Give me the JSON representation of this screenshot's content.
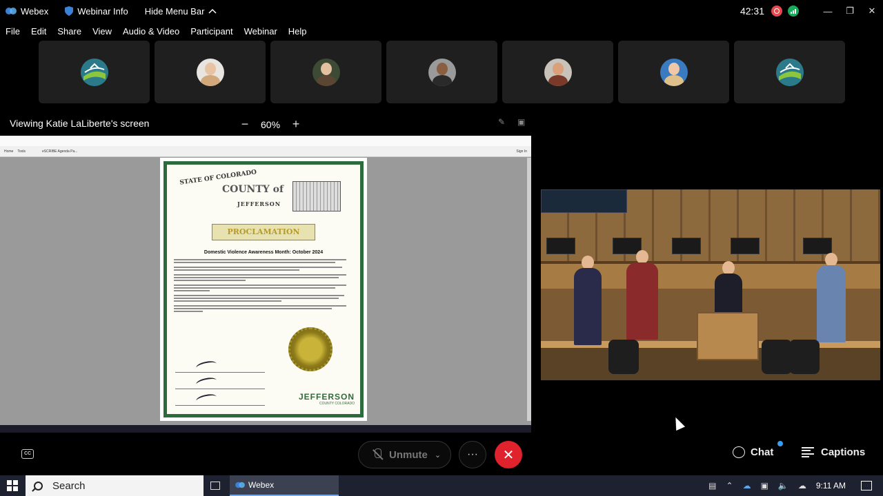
{
  "titlebar": {
    "app_name": "Webex",
    "webinar_info": "Webinar Info",
    "hide_menu": "Hide Menu Bar",
    "timer": "42:31"
  },
  "menu": [
    "File",
    "Edit",
    "Share",
    "View",
    "Audio & Video",
    "Participant",
    "Webinar",
    "Help"
  ],
  "participants": [
    {
      "avatar": "county-logo"
    },
    {
      "avatar": "woman-blonde"
    },
    {
      "avatar": "woman-dark-hair"
    },
    {
      "avatar": "man-suit"
    },
    {
      "avatar": "man-glasses"
    },
    {
      "avatar": "woman-light-hair"
    },
    {
      "avatar": "county-logo"
    }
  ],
  "share": {
    "viewing_label": "Viewing Katie LaLiberte's screen",
    "zoom_level": "60%",
    "zoom_minus": "−",
    "zoom_plus": "+"
  },
  "shared_doc": {
    "tab_home": "Home",
    "tab_tools": "Tools",
    "tab_file": "eSCRIBE Agenda Pa...",
    "sign_in": "Sign In",
    "state": "STATE OF COLORADO",
    "county": "COUNTY of",
    "county_name": "JEFFERSON",
    "ribbon": "PROCLAMATION",
    "title": "Domestic Violence Awareness Month: October 2024",
    "logo_name": "JEFFERSON",
    "logo_sub": "COUNTY COLORADO"
  },
  "controls": {
    "unmute": "Unmute",
    "more": "···",
    "end": "✕",
    "chat": "Chat",
    "captions": "Captions",
    "cc": "CC"
  },
  "taskbar": {
    "search": "Search",
    "app": "Webex",
    "time": "9:11 AM"
  },
  "colors": {
    "end_call": "#e0222c",
    "record": "#e5484d",
    "stats": "#1aab5a",
    "notify": "#3a9cf2",
    "doc_border": "#2d6b3c"
  }
}
